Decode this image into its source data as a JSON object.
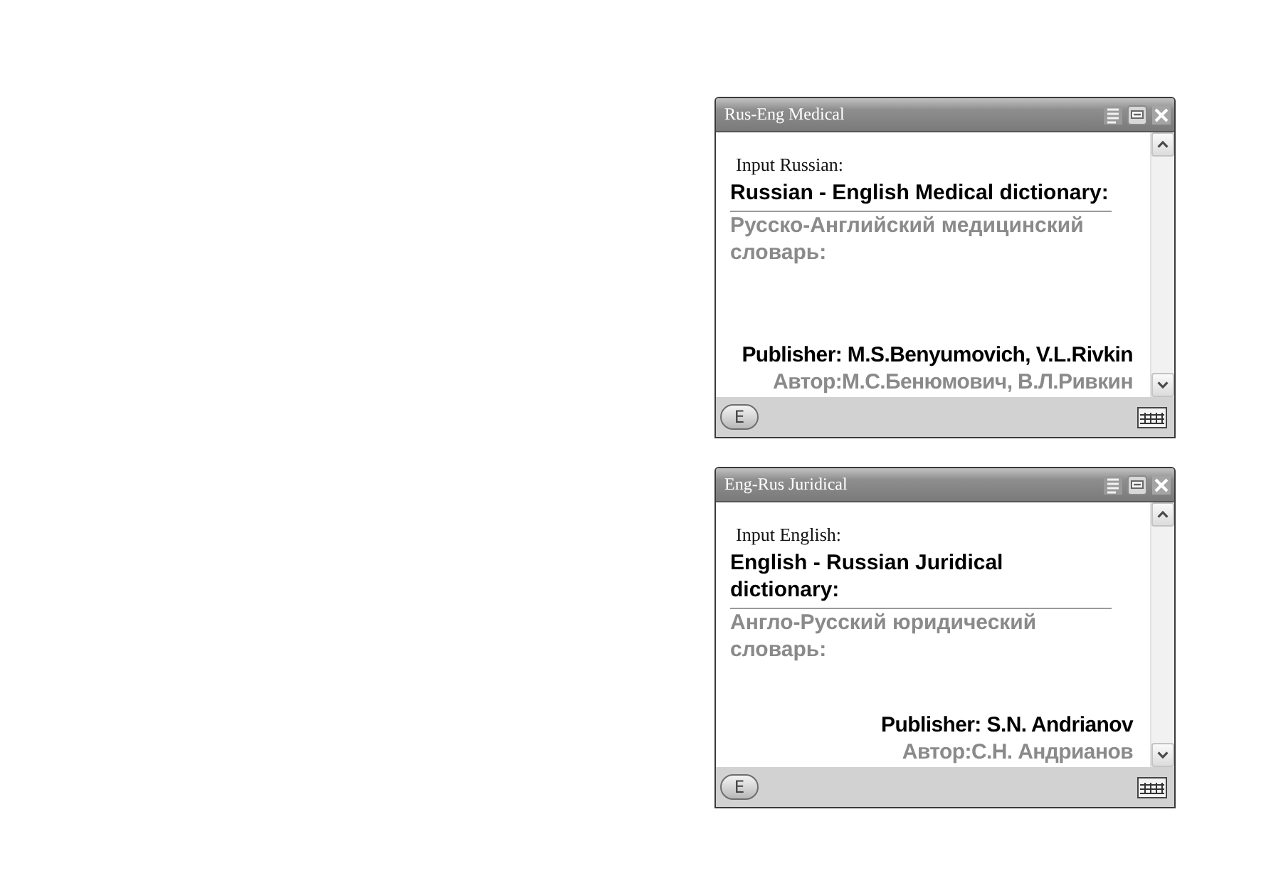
{
  "windows": [
    {
      "title": "Rus-Eng Medical",
      "prompt": "Input Russian:",
      "heading": "Russian - English Medical dictionary:",
      "heading_translation": "Русско-Английский медицинский словарь:",
      "publisher": "Publisher: M.S.Benyumovich, V.L.Rivkin",
      "author": "Автор:М.С.Бенюмович, В.Л.Ривкин",
      "mode_button": "E"
    },
    {
      "title": "Eng-Rus Juridical",
      "prompt": "Input English:",
      "heading": "English - Russian Juridical dictionary:",
      "heading_translation": "Англо-Русский юридический словарь:",
      "publisher": "Publisher: S.N. Andrianov",
      "author": "Автор:С.Н. Андрианов",
      "mode_button": "E"
    }
  ]
}
